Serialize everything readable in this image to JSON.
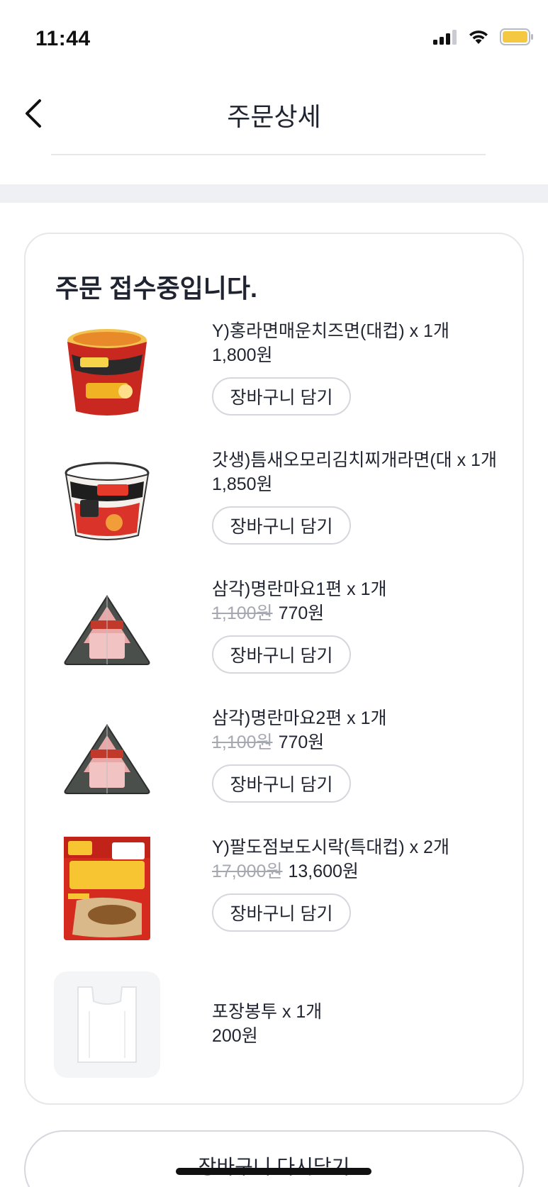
{
  "status_bar": {
    "time": "11:44"
  },
  "header": {
    "title": "주문상세"
  },
  "order": {
    "status_text": "주문 접수중입니다.",
    "add_to_cart_label": "장바구니 담기",
    "items": [
      {
        "name": "Y)홍라면매운치즈면(대컵) x 1개",
        "original_price": "",
        "price": "1,800원",
        "image": "spicy-cheese-ramen-cup"
      },
      {
        "name": "갓생)틈새오모리김치찌개라면(대 x 1개",
        "original_price": "",
        "price": "1,850원",
        "image": "kimchi-jjigae-ramen-cup"
      },
      {
        "name": "삼각)명란마요1편 x 1개",
        "original_price": "1,100원",
        "price": "770원",
        "image": "triangle-kimbap"
      },
      {
        "name": "삼각)명란마요2편 x 1개",
        "original_price": "1,100원",
        "price": "770원",
        "image": "triangle-kimbap"
      },
      {
        "name": "Y)팔도점보도시락(특대컵) x 2개",
        "original_price": "17,000원",
        "price": "13,600원",
        "image": "jumbo-dosirak-box"
      },
      {
        "name": "포장봉투 x 1개",
        "original_price": "",
        "price": "200원",
        "image": "plastic-bag"
      }
    ]
  },
  "bottom": {
    "recart_label": "장바구니 다시담기"
  },
  "colors": {
    "text": "#1f2430",
    "border": "#d5d7dc",
    "strike": "#a5a8b0",
    "battery": "#f5c842"
  }
}
